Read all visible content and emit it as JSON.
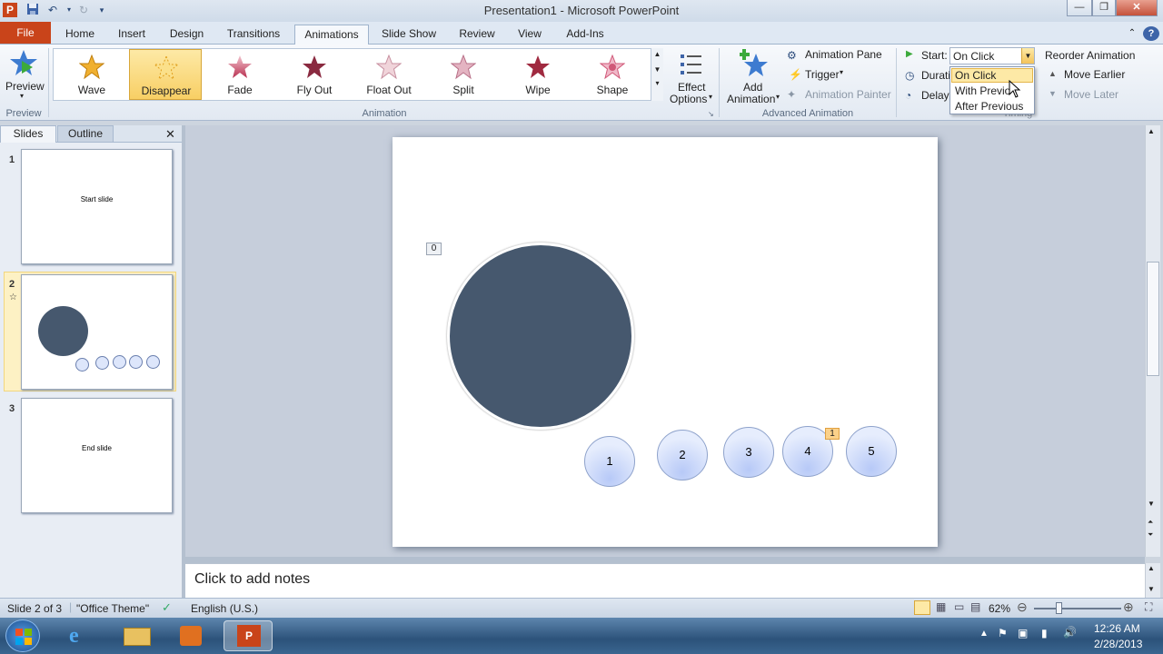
{
  "window": {
    "title": "Presentation1 - Microsoft PowerPoint",
    "app_letter": "P"
  },
  "tabs": {
    "file": "File",
    "items": [
      "Home",
      "Insert",
      "Design",
      "Transitions",
      "Animations",
      "Slide Show",
      "Review",
      "View",
      "Add-Ins"
    ],
    "active": "Animations"
  },
  "ribbon": {
    "preview_label": "Preview",
    "preview_group": "Preview",
    "animation_group": "Animation",
    "gallery": [
      {
        "label": "Wave",
        "color": "#f0b030"
      },
      {
        "label": "Disappear",
        "color": "#f5c85a",
        "selected": true
      },
      {
        "label": "Fade",
        "color": "#c0506a"
      },
      {
        "label": "Fly Out",
        "color": "#8a2a40"
      },
      {
        "label": "Float Out",
        "color": "#e8c0c8"
      },
      {
        "label": "Split",
        "color": "#d8a0b0"
      },
      {
        "label": "Wipe",
        "color": "#a02a40"
      },
      {
        "label": "Shape",
        "color": "#e07090"
      }
    ],
    "effect_options": "Effect\nOptions",
    "effect_line1": "Effect",
    "effect_line2": "Options",
    "add_animation_line1": "Add",
    "add_animation_line2": "Animation",
    "advanced_group": "Advanced Animation",
    "animation_pane": "Animation Pane",
    "trigger": "Trigger",
    "animation_painter": "Animation Painter",
    "timing": {
      "start_label": "Start:",
      "start_value": "On Click",
      "duration_label": "Durati",
      "delay_label": "Delay:",
      "options": [
        "On Click",
        "With Previo",
        "After Previous"
      ],
      "group_label": "Timing"
    },
    "reorder_title": "Reorder Animation",
    "move_earlier": "Move Earlier",
    "move_later": "Move Later"
  },
  "left_pane": {
    "tabs": [
      "Slides",
      "Outline"
    ],
    "slides": [
      {
        "num": "1",
        "text": "Start slide"
      },
      {
        "num": "2",
        "text": ""
      },
      {
        "num": "3",
        "text": "End slide"
      }
    ]
  },
  "slide": {
    "tag_zero": "0",
    "circles": [
      "1",
      "2",
      "3",
      "4",
      "5"
    ],
    "tag_one": "1",
    "big_circle_color": "#46586e"
  },
  "notes_placeholder": "Click to add notes",
  "status": {
    "slide_info": "Slide 2 of 3",
    "theme": "\"Office Theme\"",
    "language": "English (U.S.)",
    "zoom": "62%"
  },
  "taskbar": {
    "time": "12:26 AM",
    "date": "2/28/2013"
  }
}
